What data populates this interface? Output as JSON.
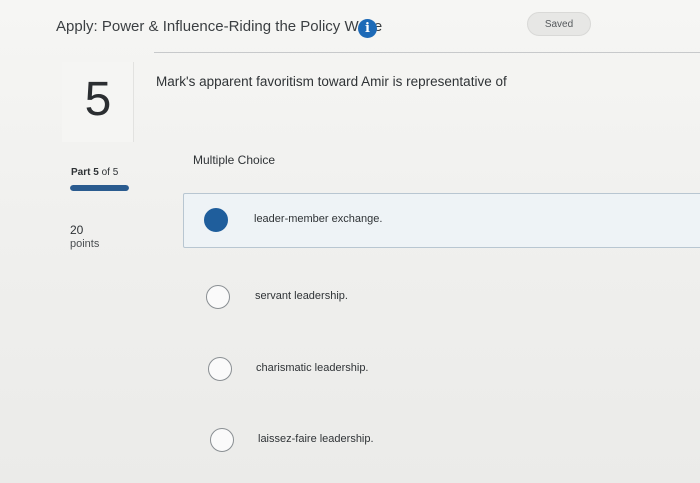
{
  "header": {
    "assignment_title": "Apply: Power & Influence-Riding the Policy Wave",
    "info_icon": "info-icon",
    "saved_label": "Saved"
  },
  "question": {
    "number": "5",
    "prompt": "Mark's apparent favoritism toward Amir is representative of",
    "type": "Multiple Choice"
  },
  "part": {
    "prefix": "Part",
    "current": "5",
    "of_text": "of 5",
    "progress_fraction": 1.0,
    "progress_color": "#2a5b8f"
  },
  "points": {
    "value": "20",
    "label": "points"
  },
  "choices": [
    {
      "label": "leader-member exchange.",
      "selected": true
    },
    {
      "label": "servant leadership.",
      "selected": false
    },
    {
      "label": "charismatic leadership.",
      "selected": false
    },
    {
      "label": "laissez-faire leadership.",
      "selected": false
    }
  ],
  "colors": {
    "accent": "#1d6ab7",
    "selected_radio": "#1f5e9c"
  }
}
